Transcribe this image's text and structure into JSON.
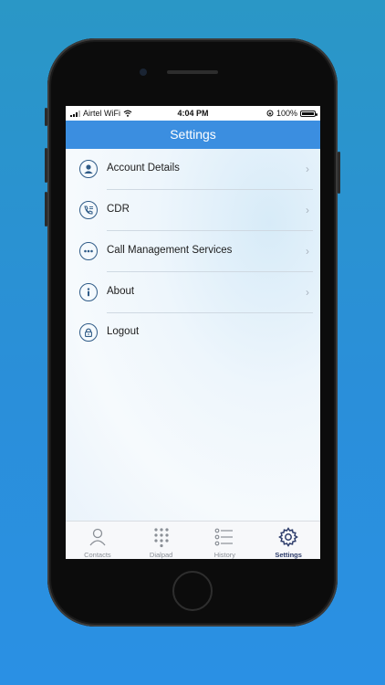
{
  "status_bar": {
    "carrier": "Airtel WiFi",
    "time": "4:04 PM",
    "battery": "100%"
  },
  "header": {
    "title": "Settings"
  },
  "menu": [
    {
      "label": "Account Details",
      "icon": "user-icon",
      "chevron": "›"
    },
    {
      "label": "CDR",
      "icon": "call-log-icon",
      "chevron": "›"
    },
    {
      "label": "Call Management Services",
      "icon": "more-dots-icon",
      "chevron": "›"
    },
    {
      "label": "About",
      "icon": "info-icon",
      "chevron": "›"
    },
    {
      "label": "Logout",
      "icon": "lock-icon"
    }
  ],
  "tabs": [
    {
      "label": "Contacts",
      "icon": "contacts-icon"
    },
    {
      "label": "Dialpad",
      "icon": "dialpad-icon"
    },
    {
      "label": "History",
      "icon": "history-icon"
    },
    {
      "label": "Settings",
      "icon": "gear-icon",
      "active": true
    }
  ],
  "colors": {
    "nav_bar": "#3b8ee0",
    "icon_stroke": "#2f5b87",
    "active_tab": "#2e3d6b",
    "background": "#2a90e4"
  }
}
